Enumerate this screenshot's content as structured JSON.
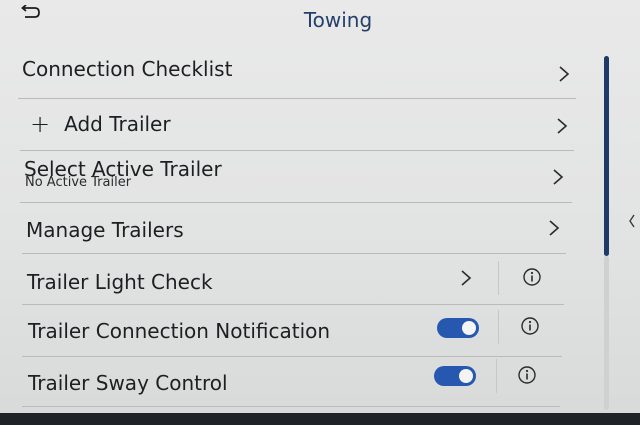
{
  "header": {
    "title": "Towing",
    "back_icon": "back-arrow-icon"
  },
  "menu": {
    "connection_checklist": "Connection Checklist",
    "add_trailer": "Add Trailer",
    "add_trailer_icon": "plus-icon",
    "select_active_trailer": "Select Active Trailer",
    "select_active_trailer_sub": "No Active Trailer",
    "manage_trailers": "Manage Trailers",
    "trailer_light_check": "Trailer Light Check",
    "trailer_connection_notification": {
      "label": "Trailer Connection Notification",
      "enabled": true
    },
    "trailer_sway_control": {
      "label": "Trailer Sway Control",
      "enabled": true
    }
  },
  "colors": {
    "title": "#243f6b",
    "toggle_on": "#2658b0",
    "scrollbar": "#1f3a66"
  }
}
